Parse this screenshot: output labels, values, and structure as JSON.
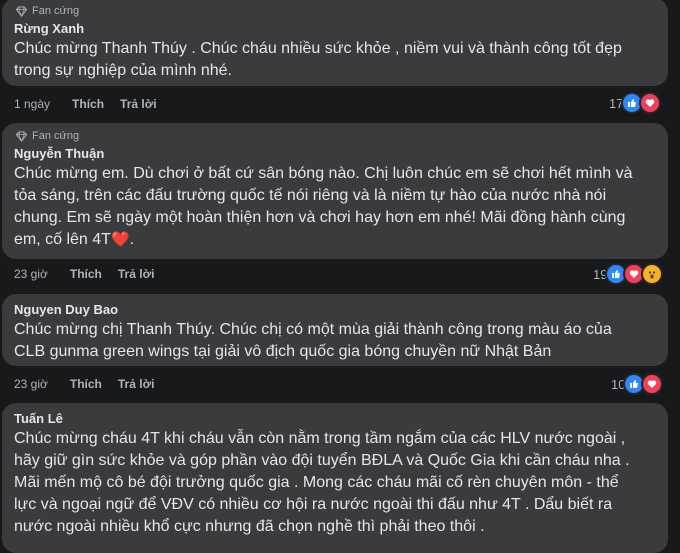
{
  "comments": [
    {
      "badge": "Fan cứng",
      "author": "Rừng Xanh",
      "text": "Chúc mừng Thanh Thúy . Chúc cháu nhiều sức khỏe , niềm vui và thành công tốt đẹp\ntrong sự nghiệp của mình nhé.",
      "time": "1 ngày",
      "like": "Thích",
      "reply": "Trả lời",
      "reaction_count": "17",
      "reactions": [
        "like-icon",
        "love-icon"
      ]
    },
    {
      "badge": "Fan cứng",
      "author": "Nguyễn Thuận",
      "text": "Chúc mừng em. Dù chơi ở bất cứ sân bóng nào. Chị luôn chúc em sẽ chơi hết mình và\ntỏa sáng, trên các đấu trường quốc tế nói riêng và là niềm tự hào của nước nhà nói\nchung. Em sẽ ngày một hoàn thiện hơn và chơi hay hơn em nhé! Mãi đồng hành cùng\nem, cố lên 4T",
      "emoji": "❤️",
      "time": "23 giờ",
      "like": "Thích",
      "reply": "Trả lời",
      "reaction_count": "19",
      "reactions": [
        "like-icon",
        "love-icon",
        "wow-icon"
      ]
    },
    {
      "author": "Nguyen Duy Bao",
      "text": "Chúc mừng chị Thanh Thúy. Chúc chị có một mùa giải thành công trong màu áo của\nCLB gunma green wings tại giải vô địch quốc gia bóng chuyền nữ Nhật Bản",
      "time": "23 giờ",
      "like": "Thích",
      "reply": "Trả lời",
      "reaction_count": "10",
      "reactions": [
        "like-icon",
        "love-icon"
      ]
    },
    {
      "author": "Tuấn Lê",
      "text": "Chúc mừng cháu 4T khi cháu vẫn còn nằm trong tầm ngắm của các HLV nước ngoài ,\nhãy giữ gìn sức khỏe và góp phần vào đội tuyển BĐLA và Quốc Gia khi cần cháu nha .\nMãi mến mộ cô bé đội trưởng quốc gia . Mong các cháu mãi cố rèn chuyên môn - thể\nlực và ngoại ngữ để VĐV có nhiều cơ hội ra nước ngoài thi đấu như 4T . Dẩu biết ra\nnước ngoài nhiều khổ cực nhưng đã chọn nghề thì phải theo thôi ."
    }
  ]
}
